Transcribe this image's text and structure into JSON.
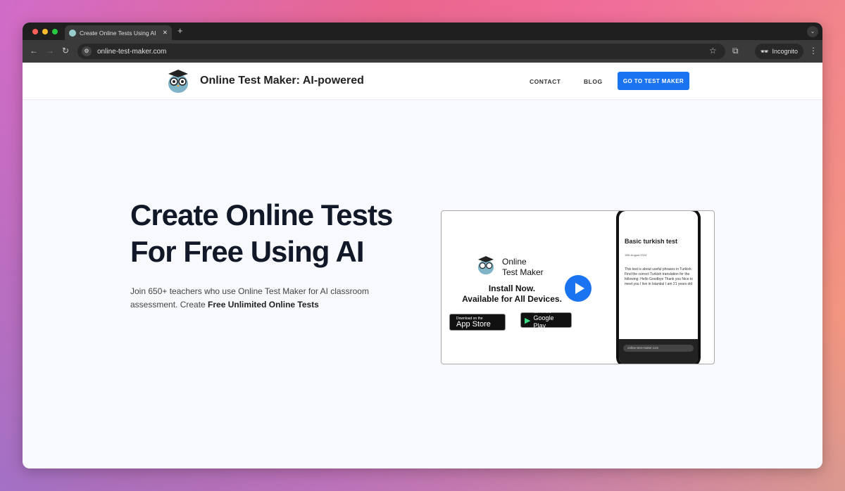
{
  "browser": {
    "tab_title": "Create Online Tests Using AI",
    "url": "online-test-maker.com",
    "profile_label": "Incognito"
  },
  "header": {
    "brand": "Online Test Maker: AI-powered",
    "nav": [
      "CONTACT",
      "BLOG"
    ],
    "cta": "GO TO TEST MAKER"
  },
  "hero": {
    "title_line1": "Create Online Tests",
    "title_line2": "For Free Using AI",
    "subtitle": "Join 650+ teachers who use Online Test Maker for AI classroom assessment. Create ",
    "subtitle_bold": "Free Unlimited Online Tests"
  },
  "video": {
    "brand_line1": "Online",
    "brand_line2": "Test Maker",
    "install_line1": "Install Now.",
    "install_line2": "Available for All Devices.",
    "appstore_small": "Download on the",
    "appstore_big": "App Store",
    "googleplay_small": "GET IT ON",
    "googleplay_big": "Google Play",
    "phone_title": "Basic turkish test",
    "phone_date": "15th August 2024",
    "phone_desc": "This test is about useful phrases in Turkish. Find the correct Turkish translation for the following: Hello Goodbye Thank you Nice to meet you I live in Istanbul I am 21 years old",
    "phone_url": "online-test-maker.com"
  },
  "colors": {
    "accent": "#1a73f0",
    "title": "#111827"
  }
}
